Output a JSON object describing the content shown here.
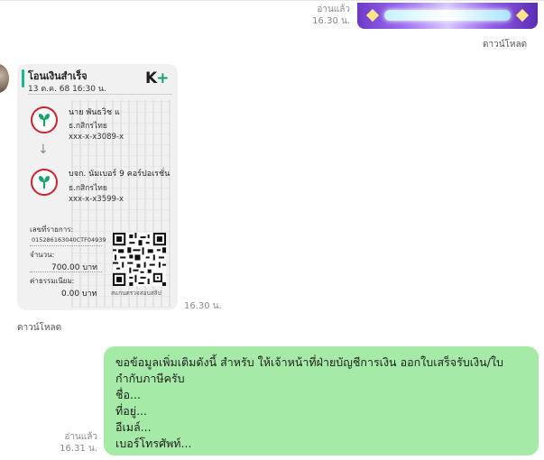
{
  "top_message": {
    "read_label": "อ่านแล้ว",
    "time": "16.30 น.",
    "download_label": "ดาวน์โหลด"
  },
  "slip": {
    "title": "โอนเงินสำเร็จ",
    "datetime": "13 ต.ค. 68  16:30 น.",
    "brand": "K",
    "brand_plus": "+",
    "sender": {
      "name": "นาย พันธวิช แ",
      "bank": "ธ.กสิกรไทย",
      "account": "xxx-x-x3089-x"
    },
    "arrow": "↓",
    "receiver": {
      "name": "บจก. นัมเบอร์ 9 คอร์ปอเรชั่น",
      "bank": "ธ.กสิกรไทย",
      "account": "xxx-x-x3599-x"
    },
    "ref_label": "เลขที่รายการ:",
    "ref_value": "015286163040CTF04939",
    "amount_label": "จำนวน:",
    "amount_value": "700.00 บาท",
    "fee_label": "ค่าธรรมเนียม:",
    "fee_value": "0.00 บาท",
    "qr_caption": "สแกนตรวจสอบสลิป",
    "time": "16.30 น.",
    "download_label": "ดาวน์โหลด",
    "colors": {
      "logo_ring": "#d0212c",
      "logo_leaf": "#13a36b",
      "accent": "#13b98b"
    }
  },
  "reply": {
    "lines": [
      "ขอข้อมูลเพิ่มเติมดังนี้ สำหรับ ให้เจ้าหน้าที่ฝ่ายบัญชีการเงิน ออกใบเสร็จรับเงิน/ใบ",
      "กำกับภาษีครับ",
      "ชื่อ...",
      "ที่อยู่...",
      "อีเมล์...",
      "เบอร์โทรศัพท์..."
    ],
    "read_label": "อ่านแล้ว",
    "time": "16.31 น.",
    "bubble_color": "#a5eaa7"
  }
}
